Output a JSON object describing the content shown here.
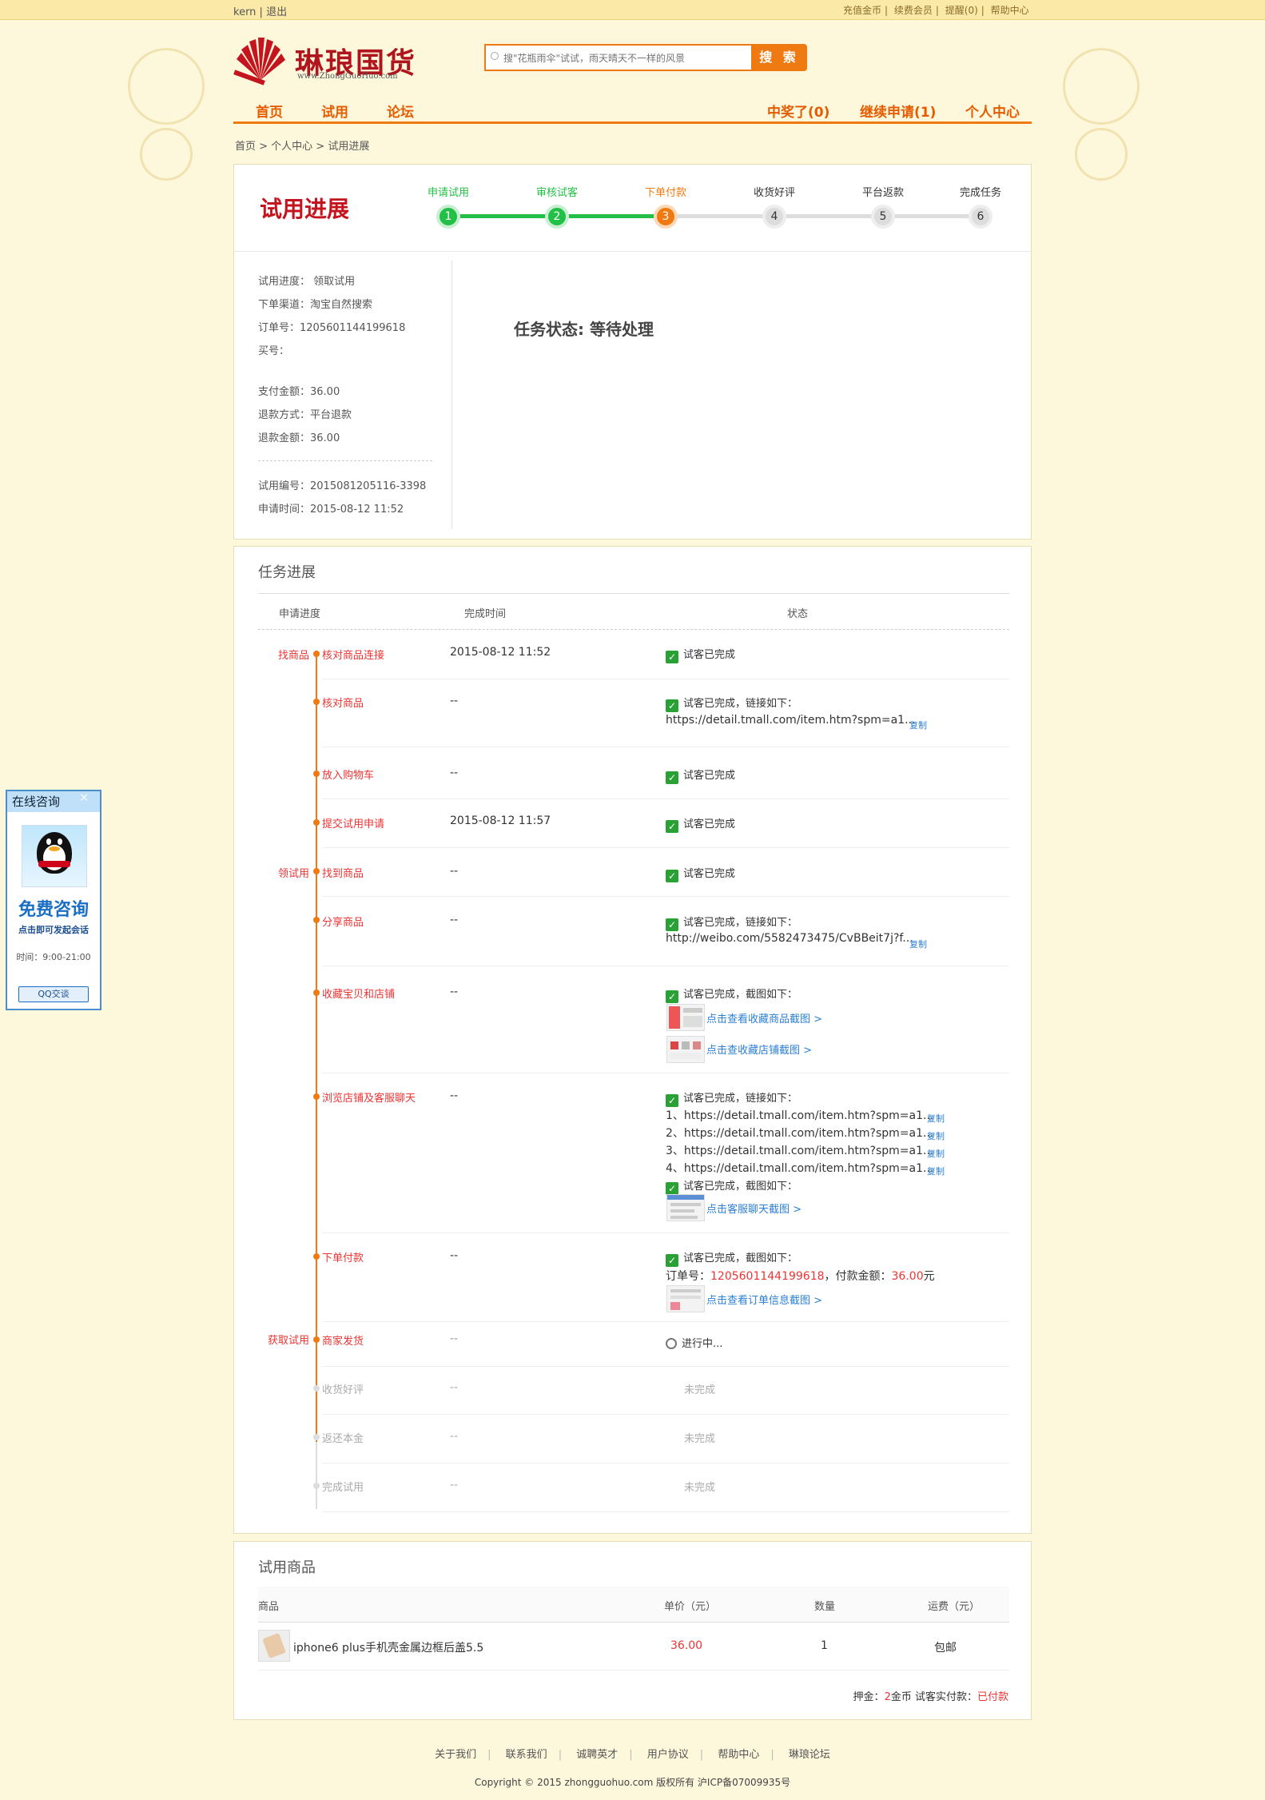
{
  "topbar": {
    "user": "kern",
    "logout": "退出",
    "links": [
      "充值金币",
      "续费会员",
      "提醒(0)",
      "帮助中心"
    ]
  },
  "header": {
    "logo_text": "琳琅国货",
    "logo_url": "www.ZhongGuoHuo.com",
    "search_placeholder": "搜\"花瓶雨伞\"试试，雨天晴天不一样的风景",
    "search_button": "搜 索"
  },
  "nav": {
    "left": [
      "首页",
      "试用",
      "论坛"
    ],
    "right": [
      "中奖了(0)",
      "继续申请(1)",
      "个人中心"
    ]
  },
  "breadcrumb": "首页 > 个人中心 > 试用进展",
  "progress": {
    "title": "试用进展",
    "steps": [
      {
        "label": "申请试用",
        "num": "1"
      },
      {
        "label": "审核试客",
        "num": "2"
      },
      {
        "label": "下单付款",
        "num": "3"
      },
      {
        "label": "收货好评",
        "num": "4"
      },
      {
        "label": "平台返款",
        "num": "5"
      },
      {
        "label": "完成任务",
        "num": "6"
      }
    ],
    "current_step": 3
  },
  "info": {
    "progress": "试用进度： 领取试用",
    "channel": "下单渠道：淘宝自然搜索",
    "order_no": "订单号：1205601144199618",
    "buyer": "买号：",
    "pay_amount": "支付金额：36.00",
    "refund_method": "退款方式：平台退款",
    "refund_amount": "退款金额：36.00",
    "trial_no": "试用编号：2015081205116-3398",
    "apply_time": "申请时间：2015-08-12 11:52",
    "task_status": "任务状态: 等待处理"
  },
  "tasks": {
    "title": "任务进展",
    "headers": [
      "申请进度",
      "完成时间",
      "状态"
    ],
    "stages": [
      "找商品",
      "领试用",
      "获取试用"
    ],
    "rows": [
      {
        "name": "核对商品连接",
        "time": "2015-08-12 11:52",
        "status": "试客已完成"
      },
      {
        "name": "核对商品",
        "time": "--",
        "status": "试客已完成，链接如下：",
        "link": "https://detail.tmall.com/item.htm?spm=a1...",
        "copy": "复制"
      },
      {
        "name": "放入购物车",
        "time": "--",
        "status": "试客已完成"
      },
      {
        "name": "提交试用申请",
        "time": "2015-08-12 11:57",
        "status": "试客已完成"
      },
      {
        "name": "找到商品",
        "time": "--",
        "status": "试客已完成"
      },
      {
        "name": "分享商品",
        "time": "--",
        "status": "试客已完成，链接如下：",
        "link": "http://weibo.com/5582473475/CvBBeit7j?f...",
        "copy": "复制"
      },
      {
        "name": "收藏宝贝和店铺",
        "time": "--",
        "status": "试客已完成，截图如下：",
        "shots": [
          "点击查看收藏商品截图 >",
          "点击查收藏店铺截图 >"
        ]
      },
      {
        "name": "浏览店铺及客服聊天",
        "time": "--",
        "status": "试客已完成，链接如下：",
        "links": [
          {
            "no": "1、",
            "url": "https://detail.tmall.com/item.htm?spm=a1...",
            "copy": "复制"
          },
          {
            "no": "2、",
            "url": "https://detail.tmall.com/item.htm?spm=a1...",
            "copy": "复制"
          },
          {
            "no": "3、",
            "url": "https://detail.tmall.com/item.htm?spm=a1...",
            "copy": "复制"
          },
          {
            "no": "4、",
            "url": "https://detail.tmall.com/item.htm?spm=a1...",
            "copy": "复制"
          }
        ],
        "status2": "试客已完成，截图如下：",
        "shot": "点击客服聊天截图 >"
      },
      {
        "name": "下单付款",
        "time": "--",
        "status": "试客已完成，截图如下：",
        "order_label": "订单号：",
        "order_no": "1205601144199618",
        "pay_label": "，付款金额：",
        "pay_amount": "36.00",
        "pay_unit": "元",
        "shot": "点击查看订单信息截图 >"
      },
      {
        "name": "商家发货",
        "time": "--",
        "status": "进行中..."
      },
      {
        "name": "收货好评",
        "time": "--",
        "status": "未完成"
      },
      {
        "name": "返还本金",
        "time": "--",
        "status": "未完成"
      },
      {
        "name": "完成试用",
        "time": "--",
        "status": "未完成"
      }
    ]
  },
  "goods": {
    "title": "试用商品",
    "headers": [
      "商品",
      "单价（元）",
      "数量",
      "运费（元）"
    ],
    "name": "iphone6 plus手机壳金属边框后盖5.5",
    "price": "36.00",
    "qty": "1",
    "shipping": "包邮",
    "deposit_label": "押金：",
    "deposit_amount": "2",
    "deposit_unit": "金币 试客实付款：",
    "paid_status": "已付款"
  },
  "footer": {
    "links": [
      "关于我们",
      "联系我们",
      "诚聘英才",
      "用户协议",
      "帮助中心",
      "琳琅论坛"
    ],
    "copyright": "Copyright © 2015 zhongguohuo.com 版权所有 沪ICP备07009935号"
  },
  "consult": {
    "title": "在线咨询",
    "free": "免费咨询",
    "sub": "点击即可发起会话",
    "hours": "时间：9:00-21:00",
    "button": "QQ交谈"
  },
  "colors": {
    "accent": "#f07a12",
    "brand_red": "#c4141e",
    "done_green": "#22c046",
    "link_blue": "#2b7fd4"
  }
}
